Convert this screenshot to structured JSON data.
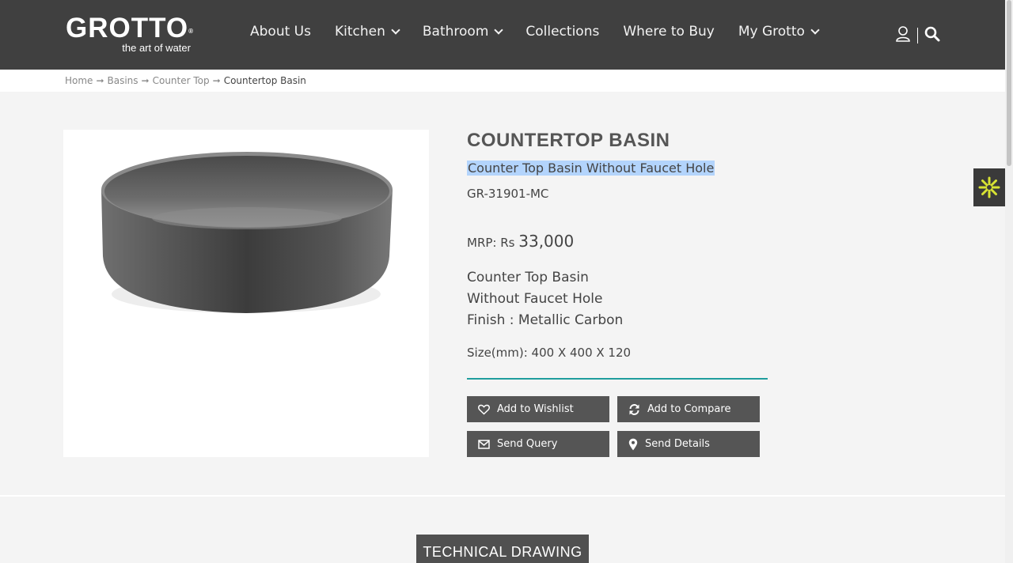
{
  "header": {
    "logo": {
      "word": "GROTTO",
      "mark": "®",
      "tagline": "the art of water"
    },
    "nav": [
      {
        "label": "About Us",
        "dropdown": false
      },
      {
        "label": "Kitchen",
        "dropdown": true
      },
      {
        "label": "Bathroom",
        "dropdown": true
      },
      {
        "label": "Collections",
        "dropdown": false
      },
      {
        "label": "Where to Buy",
        "dropdown": false
      },
      {
        "label": "My Grotto",
        "dropdown": true
      }
    ],
    "icons": [
      "user-icon",
      "search-icon"
    ]
  },
  "breadcrumb": {
    "items": [
      "Home",
      "Basins",
      "Counter Top"
    ],
    "separator": "➞",
    "current": "Countertop Basin"
  },
  "product": {
    "title": "COUNTERTOP BASIN",
    "subtitle": "Counter Top Basin Without Faucet Hole",
    "sku": "GR-31901-MC",
    "price_label": "MRP: Rs",
    "price_value": "33,000",
    "description": [
      "Counter Top Basin",
      "Without Faucet Hole",
      "Finish : Metallic Carbon"
    ],
    "size": "Size(mm): 400 X 400 X 120",
    "image_icon": "basin-image"
  },
  "actions": {
    "wishlist": "Add to Wishlist",
    "compare": "Add to Compare",
    "query": "Send Query",
    "details": "Send Details"
  },
  "section_tab": "TECHNICAL DRAWING",
  "colors": {
    "header_bg": "#404040",
    "page_bg": "#f4f4f4",
    "button_bg": "#555555",
    "accent_teal": "#1f9d9d",
    "selection": "#b3d4fc",
    "widget_flower": "#d7e233"
  }
}
